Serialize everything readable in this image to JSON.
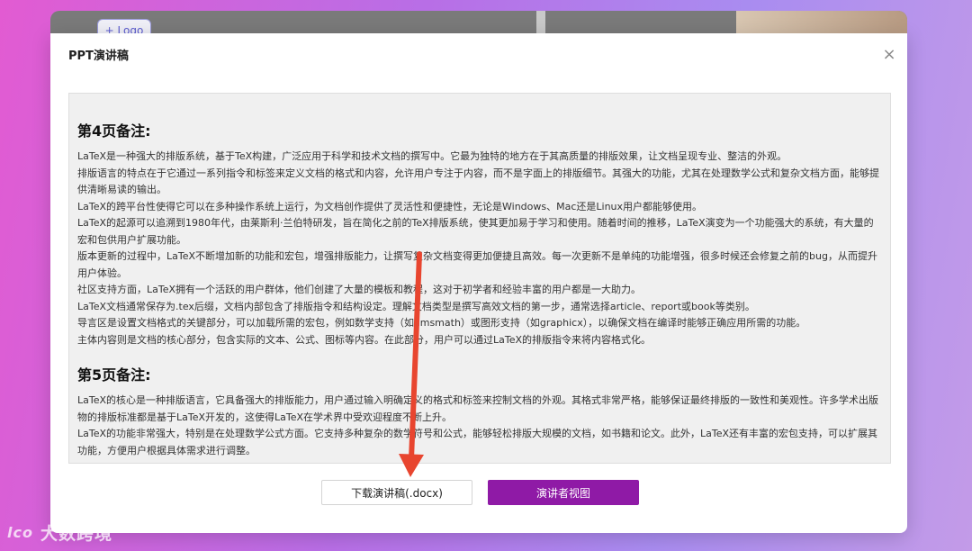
{
  "background": {
    "logo_button": "+ Logo"
  },
  "modal": {
    "title": "PPT演讲稿",
    "close_glyph": "×",
    "sections": [
      {
        "heading": "第4页备注:",
        "paragraphs": [
          "LaTeX是一种强大的排版系统，基于TeX构建，广泛应用于科学和技术文档的撰写中。它最为独特的地方在于其高质量的排版效果，让文档呈现专业、整洁的外观。",
          "排版语言的特点在于它通过一系列指令和标签来定义文档的格式和内容，允许用户专注于内容，而不是字面上的排版细节。其强大的功能，尤其在处理数学公式和复杂文档方面，能够提供清晰易读的输出。",
          "LaTeX的跨平台性使得它可以在多种操作系统上运行，为文档创作提供了灵活性和便捷性，无论是Windows、Mac还是Linux用户都能够使用。",
          "LaTeX的起源可以追溯到1980年代，由莱斯利·兰伯特研发，旨在简化之前的TeX排版系统，使其更加易于学习和使用。随着时间的推移，LaTeX演变为一个功能强大的系统，有大量的宏和包供用户扩展功能。",
          "版本更新的过程中，LaTeX不断增加新的功能和宏包，增强排版能力，让撰写复杂文档变得更加便捷且高效。每一次更新不是单纯的功能增强，很多时候还会修复之前的bug，从而提升用户体验。",
          "社区支持方面，LaTeX拥有一个活跃的用户群体，他们创建了大量的模板和教程，这对于初学者和经验丰富的用户都是一大助力。",
          "LaTeX文档通常保存为.tex后缀，文档内部包含了排版指令和结构设定。理解文档类型是撰写高效文档的第一步，通常选择article、report或book等类别。",
          "导言区是设置文档格式的关键部分，可以加载所需的宏包，例如数学支持（如amsmath）或图形支持（如graphicx），以确保文档在编译时能够正确应用所需的功能。",
          "主体内容则是文档的核心部分，包含实际的文本、公式、图标等内容。在此部分，用户可以通过LaTeX的排版指令来将内容格式化。"
        ]
      },
      {
        "heading": "第5页备注:",
        "paragraphs": [
          "LaTeX的核心是一种排版语言，它具备强大的排版能力，用户通过输入明确定义的格式和标签来控制文档的外观。其格式非常严格，能够保证最终排版的一致性和美观性。许多学术出版物的排版标准都是基于LaTeX开发的，这使得LaTeX在学术界中受欢迎程度不断上升。",
          "LaTeX的功能非常强大，特别是在处理数学公式方面。它支持多种复杂的数学符号和公式，能够轻松排版大规模的文档，如书籍和论文。此外，LaTeX还有丰富的宏包支持，可以扩展其功能，方便用户根据具体需求进行调整。"
        ]
      }
    ],
    "download_button": "下载演讲稿(.docx)",
    "presenter_button": "演讲者视图"
  },
  "colors": {
    "accent": "#8f1aa6",
    "arrow": "#e8452f"
  },
  "watermark": {
    "logo": "lco",
    "text": "大数跨境"
  }
}
